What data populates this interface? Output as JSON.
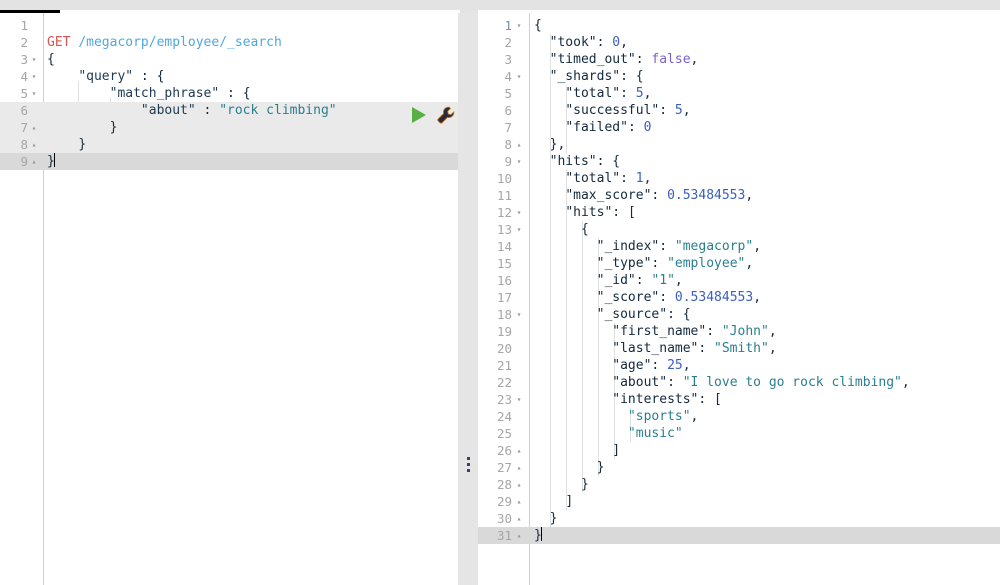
{
  "app": {
    "name": "kibana-dev-tools-console",
    "colors": {
      "chrome_bg": "#e3e3e3",
      "tab_underline": "#000000",
      "divider_bg": "#e5e5e5",
      "active_line": "#d9d9d9",
      "range_selection": "#eaeaea",
      "gutter_number": "#a6a6a6",
      "method_get": "#d9534f",
      "url": "#4fa8dd",
      "string": "#2a7f8f",
      "number": "#3b5fc0",
      "boolean": "#7a5fd3",
      "play_green": "#56b045"
    }
  },
  "toolbar": {
    "play_label": "play-request",
    "wrench_label": "request-options"
  },
  "divider": {
    "grip_label": "drag-to-resize",
    "dot_count": 3
  },
  "request_editor": {
    "name": "request-editor",
    "cursor_line": 9,
    "active_line": 9,
    "selection_lines": [
      6,
      7,
      8
    ],
    "lines": [
      {
        "n": 1,
        "fold": "",
        "text": ""
      },
      {
        "n": 2,
        "fold": "",
        "text": "GET /megacorp/employee/_search",
        "tokens": [
          {
            "t": "GET",
            "c": "t-method"
          },
          {
            "t": " ",
            "c": "t-punc"
          },
          {
            "t": "/megacorp/employee/_search",
            "c": "t-url"
          }
        ]
      },
      {
        "n": 3,
        "fold": "▾",
        "text": "{",
        "tokens": [
          {
            "t": "{",
            "c": "t-punc"
          }
        ]
      },
      {
        "n": 4,
        "fold": "▾",
        "text": "    \"query\" : {",
        "tokens": [
          {
            "t": "    ",
            "c": "t-punc"
          },
          {
            "t": "\"query\"",
            "c": "t-key"
          },
          {
            "t": " : ",
            "c": "t-punc"
          },
          {
            "t": "{",
            "c": "t-punc"
          }
        ]
      },
      {
        "n": 5,
        "fold": "▾",
        "text": "        \"match_phrase\" : {",
        "tokens": [
          {
            "t": "        ",
            "c": "t-punc"
          },
          {
            "t": "\"match_phrase\"",
            "c": "t-key"
          },
          {
            "t": " : ",
            "c": "t-punc"
          },
          {
            "t": "{",
            "c": "t-punc"
          }
        ]
      },
      {
        "n": 6,
        "fold": "",
        "text": "            \"about\" : \"rock climbing\"",
        "tokens": [
          {
            "t": "            ",
            "c": "t-punc"
          },
          {
            "t": "\"about\"",
            "c": "t-key"
          },
          {
            "t": " : ",
            "c": "t-punc"
          },
          {
            "t": "\"rock climbing\"",
            "c": "t-str"
          }
        ]
      },
      {
        "n": 7,
        "fold": "▴",
        "text": "        }",
        "tokens": [
          {
            "t": "        ",
            "c": "t-punc"
          },
          {
            "t": "}",
            "c": "t-punc"
          }
        ]
      },
      {
        "n": 8,
        "fold": "▴",
        "text": "    }",
        "tokens": [
          {
            "t": "    ",
            "c": "t-punc"
          },
          {
            "t": "}",
            "c": "t-punc"
          }
        ]
      },
      {
        "n": 9,
        "fold": "▴",
        "text": "}",
        "tokens": [
          {
            "t": "}",
            "c": "t-punc"
          }
        ]
      }
    ]
  },
  "response_editor": {
    "name": "response-viewer",
    "cursor_line": 31,
    "active_line": 31,
    "highlight_lineno": 1,
    "lines": [
      {
        "n": 1,
        "fold": "▾",
        "tokens": [
          {
            "t": "{",
            "c": "t-punc"
          }
        ]
      },
      {
        "n": 2,
        "fold": "",
        "tokens": [
          {
            "t": "  ",
            "c": "t-punc"
          },
          {
            "t": "\"took\"",
            "c": "t-rkey"
          },
          {
            "t": ": ",
            "c": "t-punc"
          },
          {
            "t": "0",
            "c": "t-num"
          },
          {
            "t": ",",
            "c": "t-punc"
          }
        ]
      },
      {
        "n": 3,
        "fold": "",
        "tokens": [
          {
            "t": "  ",
            "c": "t-punc"
          },
          {
            "t": "\"timed_out\"",
            "c": "t-rkey"
          },
          {
            "t": ": ",
            "c": "t-punc"
          },
          {
            "t": "false",
            "c": "t-bool"
          },
          {
            "t": ",",
            "c": "t-punc"
          }
        ]
      },
      {
        "n": 4,
        "fold": "▾",
        "tokens": [
          {
            "t": "  ",
            "c": "t-punc"
          },
          {
            "t": "\"_shards\"",
            "c": "t-rkey"
          },
          {
            "t": ": ",
            "c": "t-punc"
          },
          {
            "t": "{",
            "c": "t-punc"
          }
        ]
      },
      {
        "n": 5,
        "fold": "",
        "tokens": [
          {
            "t": "    ",
            "c": "t-punc"
          },
          {
            "t": "\"total\"",
            "c": "t-rkey"
          },
          {
            "t": ": ",
            "c": "t-punc"
          },
          {
            "t": "5",
            "c": "t-num"
          },
          {
            "t": ",",
            "c": "t-punc"
          }
        ]
      },
      {
        "n": 6,
        "fold": "",
        "tokens": [
          {
            "t": "    ",
            "c": "t-punc"
          },
          {
            "t": "\"successful\"",
            "c": "t-rkey"
          },
          {
            "t": ": ",
            "c": "t-punc"
          },
          {
            "t": "5",
            "c": "t-num"
          },
          {
            "t": ",",
            "c": "t-punc"
          }
        ]
      },
      {
        "n": 7,
        "fold": "",
        "tokens": [
          {
            "t": "    ",
            "c": "t-punc"
          },
          {
            "t": "\"failed\"",
            "c": "t-rkey"
          },
          {
            "t": ": ",
            "c": "t-punc"
          },
          {
            "t": "0",
            "c": "t-num"
          }
        ]
      },
      {
        "n": 8,
        "fold": "▴",
        "tokens": [
          {
            "t": "  ",
            "c": "t-punc"
          },
          {
            "t": "},",
            "c": "t-punc"
          }
        ]
      },
      {
        "n": 9,
        "fold": "▾",
        "tokens": [
          {
            "t": "  ",
            "c": "t-punc"
          },
          {
            "t": "\"hits\"",
            "c": "t-rkey"
          },
          {
            "t": ": ",
            "c": "t-punc"
          },
          {
            "t": "{",
            "c": "t-punc"
          }
        ]
      },
      {
        "n": 10,
        "fold": "",
        "tokens": [
          {
            "t": "    ",
            "c": "t-punc"
          },
          {
            "t": "\"total\"",
            "c": "t-rkey"
          },
          {
            "t": ": ",
            "c": "t-punc"
          },
          {
            "t": "1",
            "c": "t-num"
          },
          {
            "t": ",",
            "c": "t-punc"
          }
        ]
      },
      {
        "n": 11,
        "fold": "",
        "tokens": [
          {
            "t": "    ",
            "c": "t-punc"
          },
          {
            "t": "\"max_score\"",
            "c": "t-rkey"
          },
          {
            "t": ": ",
            "c": "t-punc"
          },
          {
            "t": "0.53484553",
            "c": "t-num"
          },
          {
            "t": ",",
            "c": "t-punc"
          }
        ]
      },
      {
        "n": 12,
        "fold": "▾",
        "tokens": [
          {
            "t": "    ",
            "c": "t-punc"
          },
          {
            "t": "\"hits\"",
            "c": "t-rkey"
          },
          {
            "t": ": ",
            "c": "t-punc"
          },
          {
            "t": "[",
            "c": "t-punc"
          }
        ]
      },
      {
        "n": 13,
        "fold": "▾",
        "tokens": [
          {
            "t": "      ",
            "c": "t-punc"
          },
          {
            "t": "{",
            "c": "t-punc"
          }
        ]
      },
      {
        "n": 14,
        "fold": "",
        "tokens": [
          {
            "t": "        ",
            "c": "t-punc"
          },
          {
            "t": "\"_index\"",
            "c": "t-rkey"
          },
          {
            "t": ": ",
            "c": "t-punc"
          },
          {
            "t": "\"megacorp\"",
            "c": "t-str"
          },
          {
            "t": ",",
            "c": "t-punc"
          }
        ]
      },
      {
        "n": 15,
        "fold": "",
        "tokens": [
          {
            "t": "        ",
            "c": "t-punc"
          },
          {
            "t": "\"_type\"",
            "c": "t-rkey"
          },
          {
            "t": ": ",
            "c": "t-punc"
          },
          {
            "t": "\"employee\"",
            "c": "t-str"
          },
          {
            "t": ",",
            "c": "t-punc"
          }
        ]
      },
      {
        "n": 16,
        "fold": "",
        "tokens": [
          {
            "t": "        ",
            "c": "t-punc"
          },
          {
            "t": "\"_id\"",
            "c": "t-rkey"
          },
          {
            "t": ": ",
            "c": "t-punc"
          },
          {
            "t": "\"1\"",
            "c": "t-str"
          },
          {
            "t": ",",
            "c": "t-punc"
          }
        ]
      },
      {
        "n": 17,
        "fold": "",
        "tokens": [
          {
            "t": "        ",
            "c": "t-punc"
          },
          {
            "t": "\"_score\"",
            "c": "t-rkey"
          },
          {
            "t": ": ",
            "c": "t-punc"
          },
          {
            "t": "0.53484553",
            "c": "t-num"
          },
          {
            "t": ",",
            "c": "t-punc"
          }
        ]
      },
      {
        "n": 18,
        "fold": "▾",
        "tokens": [
          {
            "t": "        ",
            "c": "t-punc"
          },
          {
            "t": "\"_source\"",
            "c": "t-rkey"
          },
          {
            "t": ": ",
            "c": "t-punc"
          },
          {
            "t": "{",
            "c": "t-punc"
          }
        ]
      },
      {
        "n": 19,
        "fold": "",
        "tokens": [
          {
            "t": "          ",
            "c": "t-punc"
          },
          {
            "t": "\"first_name\"",
            "c": "t-rkey"
          },
          {
            "t": ": ",
            "c": "t-punc"
          },
          {
            "t": "\"John\"",
            "c": "t-str"
          },
          {
            "t": ",",
            "c": "t-punc"
          }
        ]
      },
      {
        "n": 20,
        "fold": "",
        "tokens": [
          {
            "t": "          ",
            "c": "t-punc"
          },
          {
            "t": "\"last_name\"",
            "c": "t-rkey"
          },
          {
            "t": ": ",
            "c": "t-punc"
          },
          {
            "t": "\"Smith\"",
            "c": "t-str"
          },
          {
            "t": ",",
            "c": "t-punc"
          }
        ]
      },
      {
        "n": 21,
        "fold": "",
        "tokens": [
          {
            "t": "          ",
            "c": "t-punc"
          },
          {
            "t": "\"age\"",
            "c": "t-rkey"
          },
          {
            "t": ": ",
            "c": "t-punc"
          },
          {
            "t": "25",
            "c": "t-num"
          },
          {
            "t": ",",
            "c": "t-punc"
          }
        ]
      },
      {
        "n": 22,
        "fold": "",
        "tokens": [
          {
            "t": "          ",
            "c": "t-punc"
          },
          {
            "t": "\"about\"",
            "c": "t-rkey"
          },
          {
            "t": ": ",
            "c": "t-punc"
          },
          {
            "t": "\"I love to go rock climbing\"",
            "c": "t-str"
          },
          {
            "t": ",",
            "c": "t-punc"
          }
        ]
      },
      {
        "n": 23,
        "fold": "▾",
        "tokens": [
          {
            "t": "          ",
            "c": "t-punc"
          },
          {
            "t": "\"interests\"",
            "c": "t-rkey"
          },
          {
            "t": ": ",
            "c": "t-punc"
          },
          {
            "t": "[",
            "c": "t-punc"
          }
        ]
      },
      {
        "n": 24,
        "fold": "",
        "tokens": [
          {
            "t": "            ",
            "c": "t-punc"
          },
          {
            "t": "\"sports\"",
            "c": "t-str"
          },
          {
            "t": ",",
            "c": "t-punc"
          }
        ]
      },
      {
        "n": 25,
        "fold": "",
        "tokens": [
          {
            "t": "            ",
            "c": "t-punc"
          },
          {
            "t": "\"music\"",
            "c": "t-str"
          }
        ]
      },
      {
        "n": 26,
        "fold": "▴",
        "tokens": [
          {
            "t": "          ",
            "c": "t-punc"
          },
          {
            "t": "]",
            "c": "t-punc"
          }
        ]
      },
      {
        "n": 27,
        "fold": "▴",
        "tokens": [
          {
            "t": "        ",
            "c": "t-punc"
          },
          {
            "t": "}",
            "c": "t-punc"
          }
        ]
      },
      {
        "n": 28,
        "fold": "▴",
        "tokens": [
          {
            "t": "      ",
            "c": "t-punc"
          },
          {
            "t": "}",
            "c": "t-punc"
          }
        ]
      },
      {
        "n": 29,
        "fold": "▴",
        "tokens": [
          {
            "t": "    ",
            "c": "t-punc"
          },
          {
            "t": "]",
            "c": "t-punc"
          }
        ]
      },
      {
        "n": 30,
        "fold": "▴",
        "tokens": [
          {
            "t": "  ",
            "c": "t-punc"
          },
          {
            "t": "}",
            "c": "t-punc"
          }
        ]
      },
      {
        "n": 31,
        "fold": "▴",
        "tokens": [
          {
            "t": "}",
            "c": "t-punc"
          }
        ]
      }
    ]
  }
}
